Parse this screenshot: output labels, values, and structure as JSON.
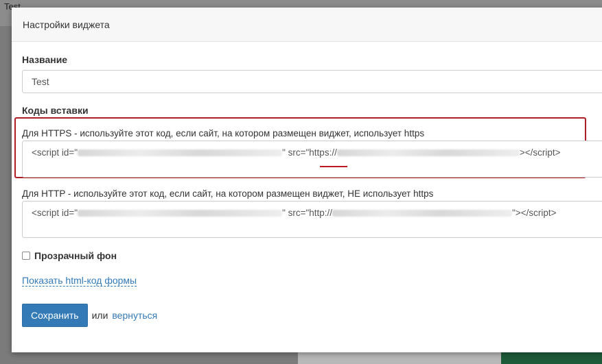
{
  "background": {
    "tab_title": "Test"
  },
  "modal": {
    "title": "Настройки виджета",
    "name_label": "Название",
    "name_value": "Test",
    "codes_label": "Коды вставки",
    "https_label": "Для HTTPS - используйте этот код, если сайт, на котором размещен виджет, использует https",
    "https_code_prefix": "<script id=\"",
    "https_code_mid": "\" src=\"",
    "https_code_scheme": "https://",
    "https_code_suffix": "></script>",
    "http_label": "Для HTTP - используйте этот код, если сайт, на котором размещен виджет, НЕ использует https",
    "http_code_prefix": "<script id=\"",
    "http_code_mid": "\" src=\"http://",
    "http_code_suffix": "\"></script>",
    "transparent_label": "Прозрачный фон",
    "transparent_checked": false,
    "show_form_link": "Показать html-код формы",
    "save_label": "Сохранить",
    "or_text": "или",
    "back_link": "вернуться"
  },
  "colors": {
    "primary": "#337ab7",
    "highlight": "#b01d24",
    "accent_green": "#1e5b3a"
  }
}
